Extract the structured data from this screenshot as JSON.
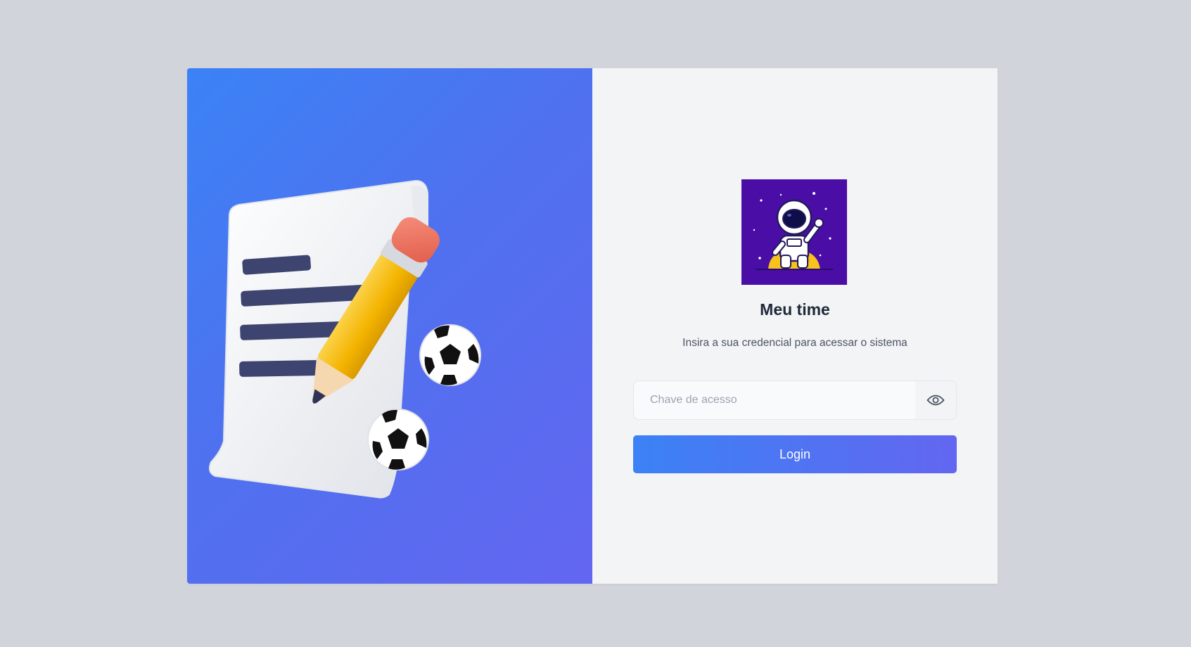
{
  "app": {
    "title": "Meu time",
    "subtitle": "Insira a sua credencial para acessar o sistema"
  },
  "form": {
    "access_key": {
      "value": "",
      "placeholder": "Chave de acesso",
      "toggle_icon": "eye-icon"
    },
    "login_label": "Login"
  },
  "images": {
    "hero": "document-pencil-soccer-balls-illustration",
    "logo": "astronaut-on-moon-logo"
  },
  "colors": {
    "page_background": "#d1d5db",
    "hero_gradient_start": "#3b82f6",
    "hero_gradient_end": "#6366f1",
    "panel_background": "#f3f4f6",
    "logo_background": "#4a0ea6",
    "title_text": "#1f2937",
    "button_text": "#ffffff"
  }
}
